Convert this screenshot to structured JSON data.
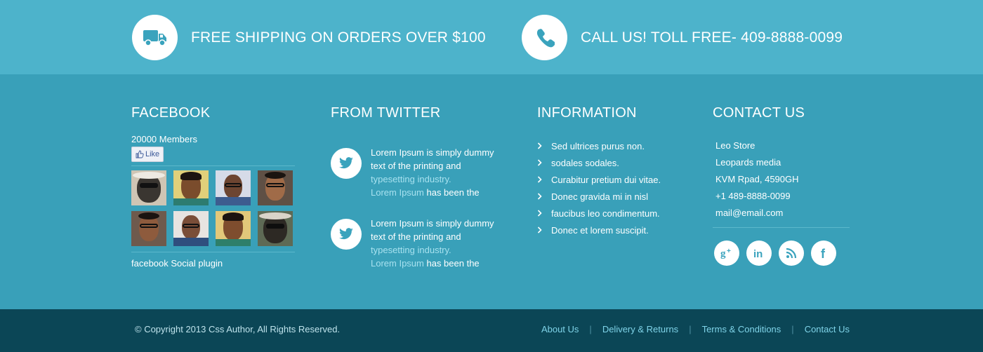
{
  "promos": {
    "shipping": {
      "text": "FREE SHIPPING ON ORDERS OVER $100",
      "icon": "truck-icon"
    },
    "call": {
      "text": "CALL US! TOLL FREE- 409-8888-0099",
      "icon": "phone-icon"
    }
  },
  "facebook": {
    "title": "FACEBOOK",
    "members": "20000 Members",
    "like_label": "Like",
    "plugin_label": "facebook Social plugin"
  },
  "twitter": {
    "title": "FROM TWITTER",
    "tweets": [
      {
        "lead": "Lorem Ipsum is simply dummy text of the printing and ",
        "link1": "typesetting industry.",
        "link2": "Lorem Ipsum",
        "tail": " has been the"
      },
      {
        "lead": "Lorem Ipsum is simply dummy text of the printing and ",
        "link1": "typesetting industry.",
        "link2": "Lorem Ipsum",
        "tail": " has been the"
      }
    ]
  },
  "information": {
    "title": "INFORMATION",
    "items": [
      "Sed ultrices purus non.",
      "sodales sodales.",
      "Curabitur pretium dui vitae.",
      "Donec gravida mi in nisl",
      "faucibus leo condimentum.",
      "Donec et lorem suscipit."
    ]
  },
  "contact": {
    "title": "CONTACT US",
    "lines": [
      "Leo Store",
      "Leopards media",
      "KVM Rpad, 4590GH",
      "+1 489-8888-0099",
      "mail@email.com"
    ],
    "social": [
      "google-plus-icon",
      "linkedin-icon",
      "rss-icon",
      "facebook-icon"
    ]
  },
  "footer": {
    "copyright": "© Copyright 2013 Css Author, All Rights Reserved.",
    "links": [
      "About Us",
      "Delivery & Returns",
      "Terms & Conditions",
      "Contact Us"
    ],
    "divider": "|"
  },
  "colors": {
    "topbar": "#4db3cb",
    "main": "#39a0b9",
    "bottom": "#0b4656",
    "accent": "#3aa3bd"
  }
}
